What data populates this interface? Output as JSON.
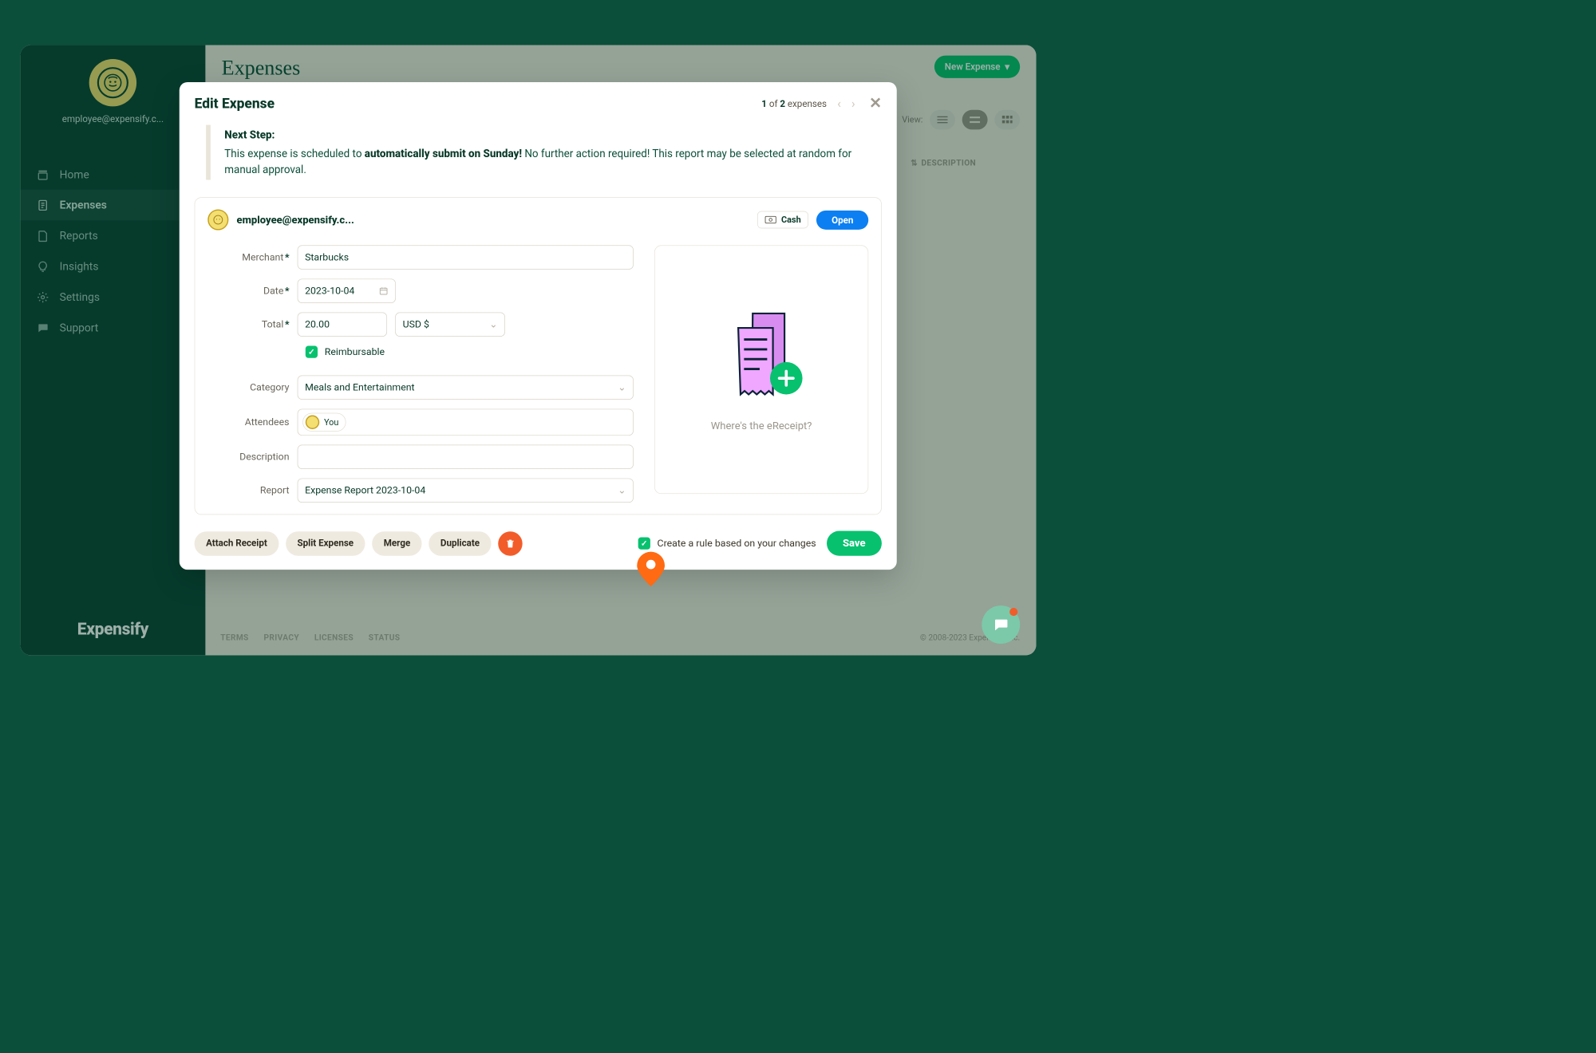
{
  "page": {
    "title": "Expenses",
    "new_expense_btn": "New Expense",
    "view_label": "View:",
    "desc_column": "DESCRIPTION"
  },
  "user": {
    "email": "employee@expensify.c..."
  },
  "nav": {
    "items": [
      {
        "label": "Home"
      },
      {
        "label": "Expenses"
      },
      {
        "label": "Reports"
      },
      {
        "label": "Insights"
      },
      {
        "label": "Settings"
      },
      {
        "label": "Support"
      }
    ]
  },
  "brand": "Expensify",
  "modal": {
    "title": "Edit Expense",
    "pager": {
      "current": "1",
      "of_word": "of",
      "total": "2",
      "suffix": "expenses"
    },
    "next_step": {
      "label": "Next Step:",
      "pre": "This expense is scheduled to ",
      "bold": "automatically submit on Sunday!",
      "post": " No further action required! This report may be selected at random for manual approval."
    },
    "card": {
      "email": "employee@expensify.c...",
      "cash_label": "Cash",
      "open_label": "Open"
    },
    "labels": {
      "merchant": "Merchant",
      "date": "Date",
      "total": "Total",
      "reimbursable": "Reimbursable",
      "category": "Category",
      "attendees": "Attendees",
      "description": "Description",
      "report": "Report"
    },
    "values": {
      "merchant": "Starbucks",
      "date": "2023-10-04",
      "total": "20.00",
      "currency": "USD $",
      "category": "Meals and Entertainment",
      "attendee_chip": "You",
      "description": "",
      "report": "Expense Report 2023-10-04"
    },
    "receipt_placeholder": "Where's the eReceipt?",
    "footer": {
      "attach": "Attach Receipt",
      "split": "Split Expense",
      "merge": "Merge",
      "duplicate": "Duplicate",
      "rule": "Create a rule based on your changes",
      "save": "Save"
    }
  },
  "footer_links": [
    "TERMS",
    "PRIVACY",
    "LICENSES",
    "STATUS"
  ],
  "copyright": "© 2008-2023 Expensify, Inc."
}
